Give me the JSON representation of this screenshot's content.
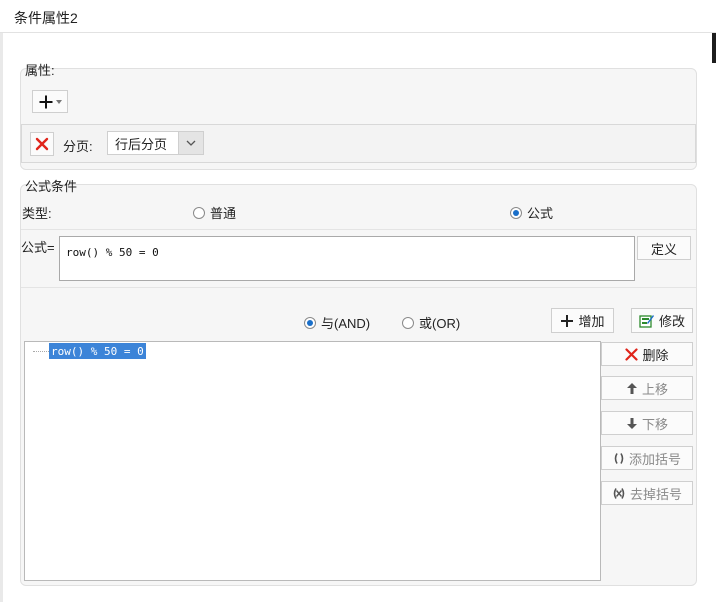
{
  "window": {
    "title": "条件属性2"
  },
  "properties": {
    "section_label": "属性:",
    "add_button_icon": "plus-icon",
    "page_break_label": "分页:",
    "page_break_value": "行后分页"
  },
  "formula_condition": {
    "section_label": "公式条件",
    "type_label": "类型:",
    "type_option_normal": "普通",
    "type_option_formula": "公式",
    "type_selected": "公式",
    "formula_label": "公式=",
    "formula_value": "row() % 50 = 0",
    "define_button": "定义",
    "logic_and": "与(AND)",
    "logic_or": "或(OR)",
    "logic_selected": "与(AND)",
    "add_button": "增加",
    "modify_button": "修改",
    "conditions": [
      "row() % 50 = 0"
    ],
    "delete_button": "删除",
    "move_up_button": "上移",
    "move_down_button": "下移",
    "add_bracket_button": "添加括号",
    "remove_bracket_button": "去掉括号"
  }
}
